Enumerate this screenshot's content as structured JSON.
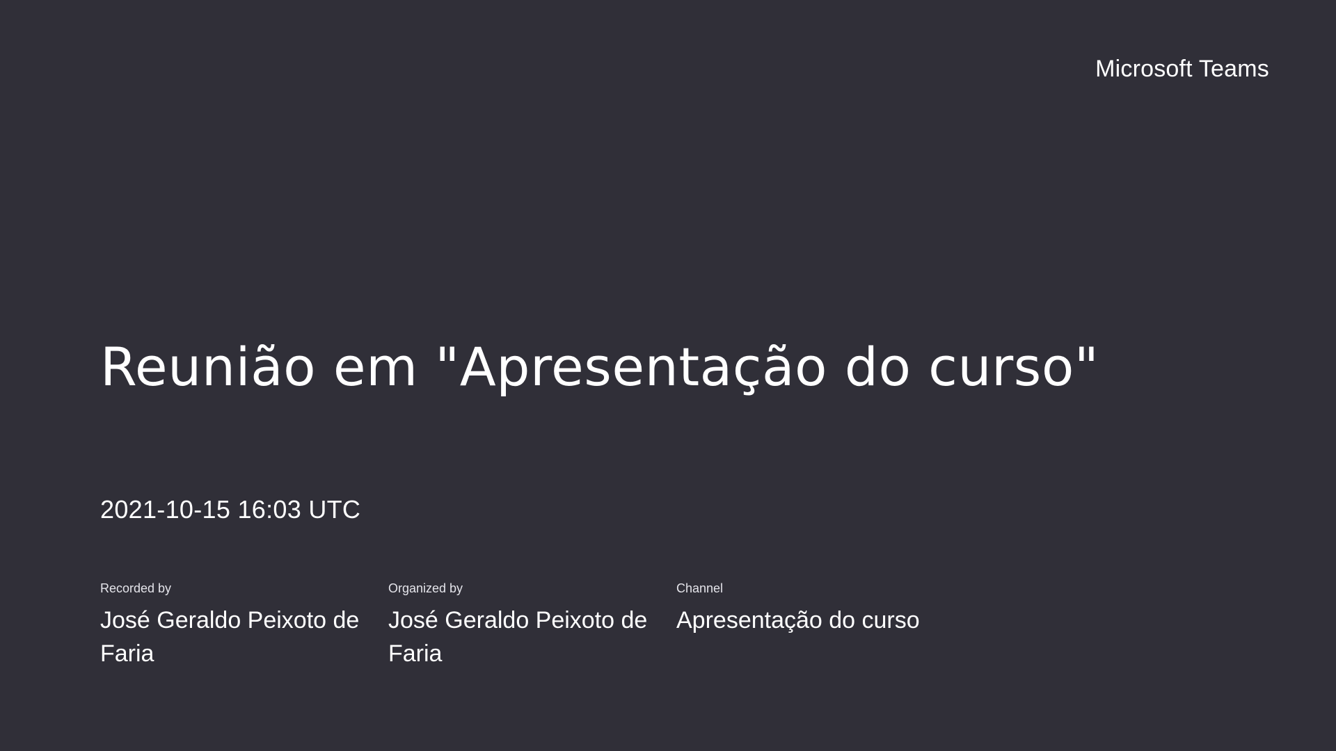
{
  "header": {
    "brand": "Microsoft Teams"
  },
  "meeting": {
    "title": "Reunião em \"Apresentação do curso\"",
    "datetime": "2021-10-15 16:03 UTC"
  },
  "details": [
    {
      "label": "Recorded by",
      "value": "José Geraldo Peixoto de Faria"
    },
    {
      "label": "Organized by",
      "value": "José Geraldo Peixoto de Faria"
    },
    {
      "label": "Channel",
      "value": "Apresentação do curso"
    }
  ],
  "colors": {
    "background": "#302f38",
    "text": "#ffffff"
  }
}
